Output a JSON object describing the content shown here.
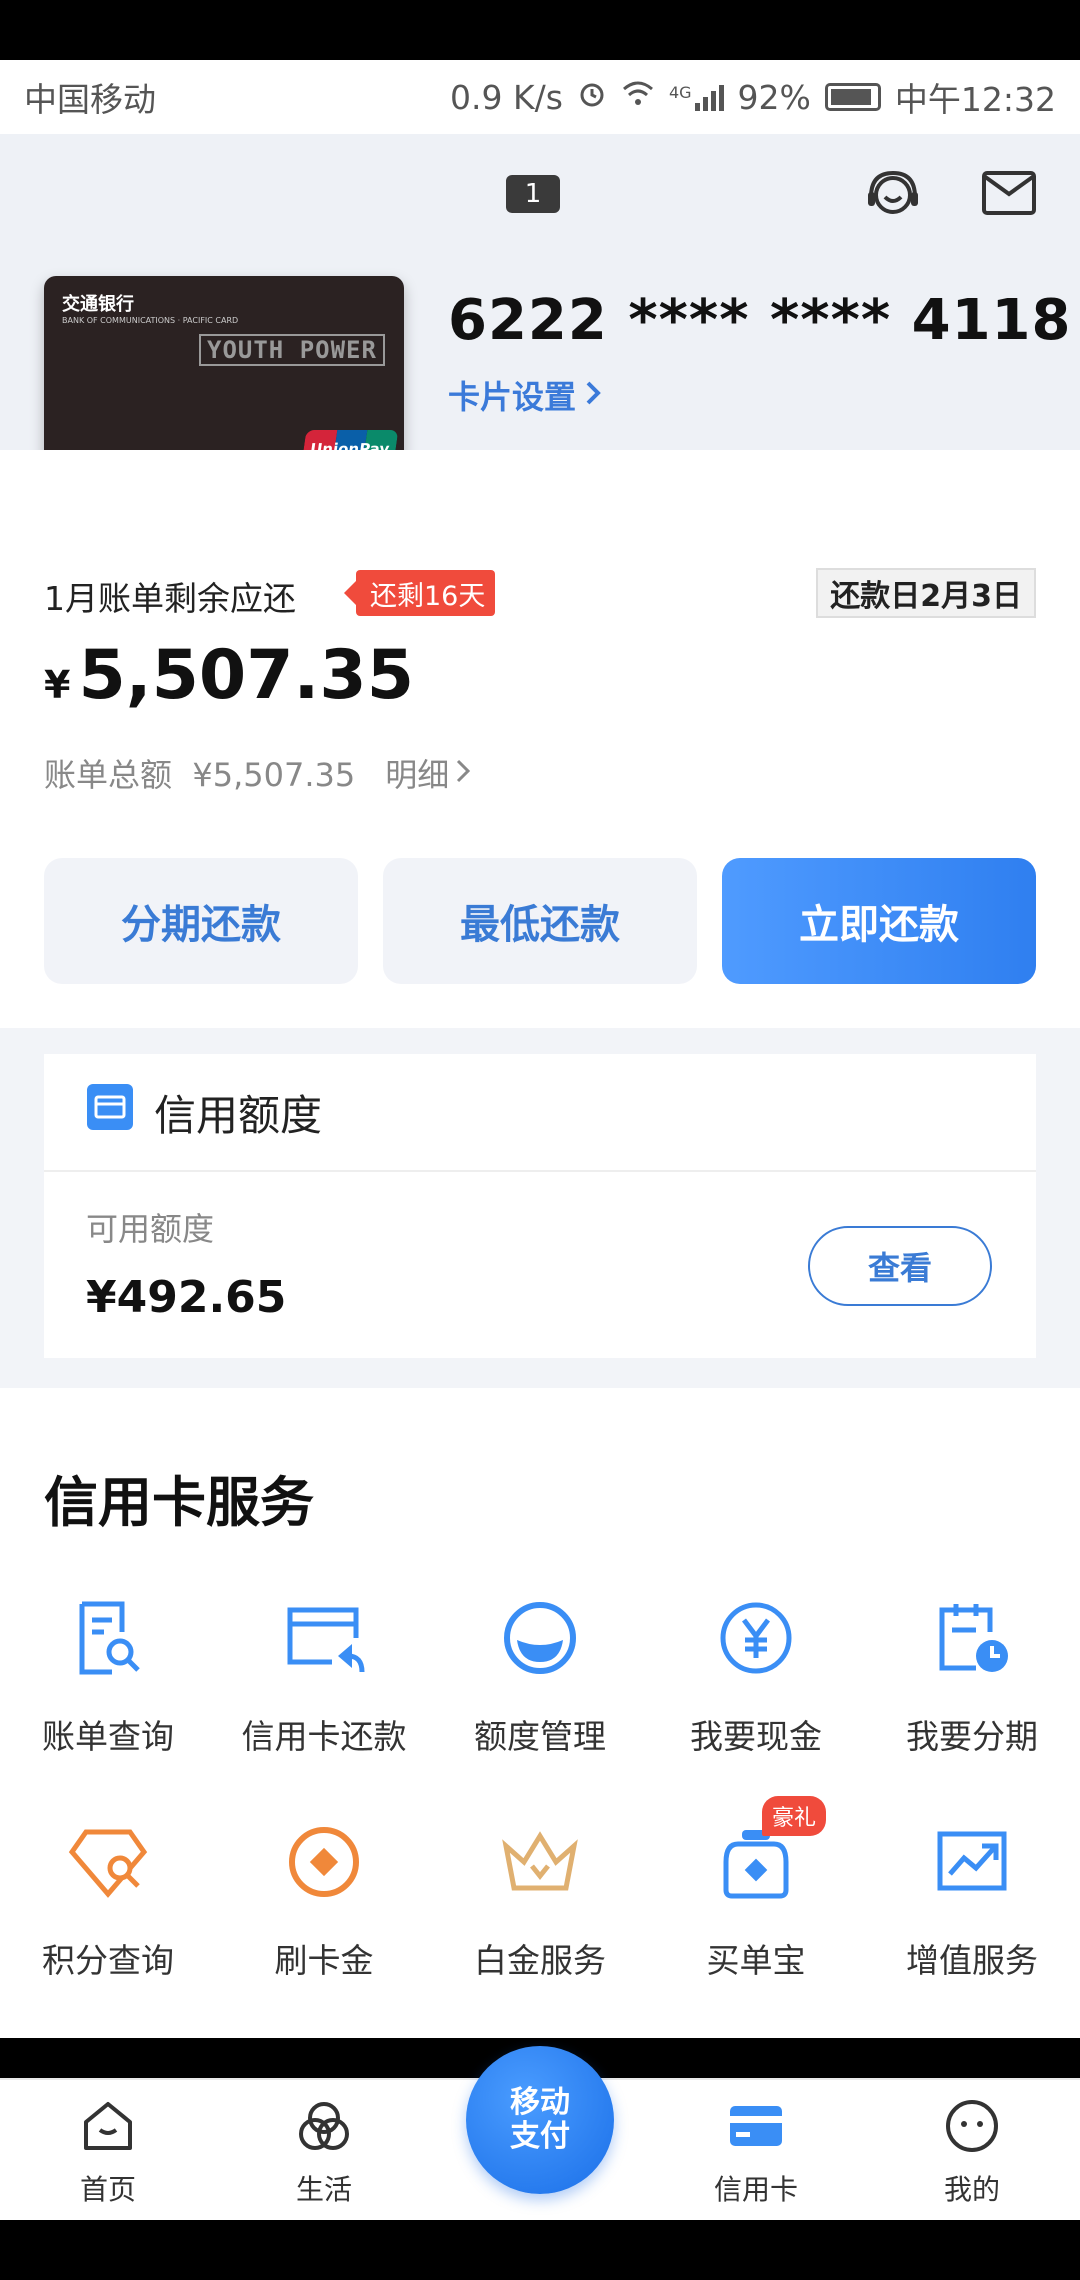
{
  "status_bar": {
    "carrier": "中国移动",
    "speed": "0.9 K/s",
    "network": "4G",
    "battery": "92%",
    "time": "中午12:32"
  },
  "header": {
    "notification_count": "1",
    "icons": [
      "customer-service-icon",
      "mail-icon"
    ]
  },
  "card": {
    "bank_name": "交通银行",
    "bank_sub": "BANK OF COMMUNICATIONS · PACIFIC CARD",
    "card_art_text": "YOUTH POWER",
    "network_brand": "UnionPay 银联",
    "number": "6222 **** **** 4118",
    "settings_label": "卡片设置"
  },
  "bill": {
    "label": "1月账单剩余应还",
    "remaining_days": "还剩16天",
    "due_date": "还款日2月3日",
    "currency": "¥",
    "amount": "5,507.35",
    "total_label": "账单总额",
    "total_value": "¥5,507.35",
    "detail_label": "明细"
  },
  "actions": {
    "installment": "分期还款",
    "minimum": "最低还款",
    "pay_now": "立即还款"
  },
  "credit": {
    "title": "信用额度",
    "available_label": "可用额度",
    "available_value": "¥492.65",
    "view_label": "查看"
  },
  "services": {
    "title": "信用卡服务",
    "items": [
      {
        "label": "账单查询",
        "icon": "bill-search-icon"
      },
      {
        "label": "信用卡还款",
        "icon": "card-repay-icon"
      },
      {
        "label": "额度管理",
        "icon": "limit-manage-icon"
      },
      {
        "label": "我要现金",
        "icon": "cash-icon"
      },
      {
        "label": "我要分期",
        "icon": "installment-icon"
      },
      {
        "label": "积分查询",
        "icon": "points-icon"
      },
      {
        "label": "刷卡金",
        "icon": "swipe-gold-icon"
      },
      {
        "label": "白金服务",
        "icon": "crown-icon"
      },
      {
        "label": "买单宝",
        "icon": "bag-icon",
        "badge": "豪礼"
      },
      {
        "label": "增值服务",
        "icon": "chart-icon"
      }
    ]
  },
  "bottom_nav": {
    "items": [
      {
        "label": "首页",
        "icon": "home-icon"
      },
      {
        "label": "生活",
        "icon": "life-icon"
      },
      {
        "label": "信用卡",
        "icon": "credit-card-icon",
        "active": true
      },
      {
        "label": "我的",
        "icon": "profile-icon"
      }
    ],
    "pay_button": {
      "line1": "移动",
      "line2": "支付"
    }
  },
  "colors": {
    "accent": "#3a7bd5",
    "primary_button": "#2f7ff0",
    "alert": "#f04b3c",
    "orange_icon": "#f0883a",
    "gold_icon": "#e0b070"
  }
}
